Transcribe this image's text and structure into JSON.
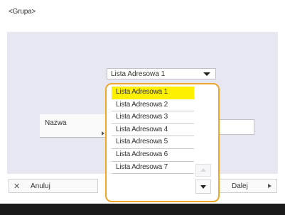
{
  "screen": {
    "title": "<Grupa>"
  },
  "list_selector": {
    "value": "Lista Adresowa 1"
  },
  "name_row": {
    "label": "Nazwa",
    "value": ""
  },
  "buttons": {
    "cancel_label": "Anuluj",
    "next_label": "Dalej"
  },
  "dropdown": {
    "selected": "Lista Adresowa 1",
    "items": [
      {
        "label": "Lista Adresowa 1"
      },
      {
        "label": "Lista Adresowa 2"
      },
      {
        "label": "Lista Adresowa 3"
      },
      {
        "label": "Lista Adresowa 4"
      },
      {
        "label": "Lista Adresowa 5"
      },
      {
        "label": "Lista Adresowa 6"
      },
      {
        "label": "Lista Adresowa 7"
      }
    ]
  },
  "icons": {
    "cancel": "close-icon",
    "next": "play-icon",
    "combo": "chevron-down-icon",
    "scroll_up": "scroll-up-icon",
    "scroll_down": "scroll-down-icon"
  },
  "colors": {
    "highlight": "#fdf000",
    "dropdown_border": "#f0a628",
    "panel_background": "#e6e7f0",
    "footer_bar": "#1a1a1a"
  }
}
